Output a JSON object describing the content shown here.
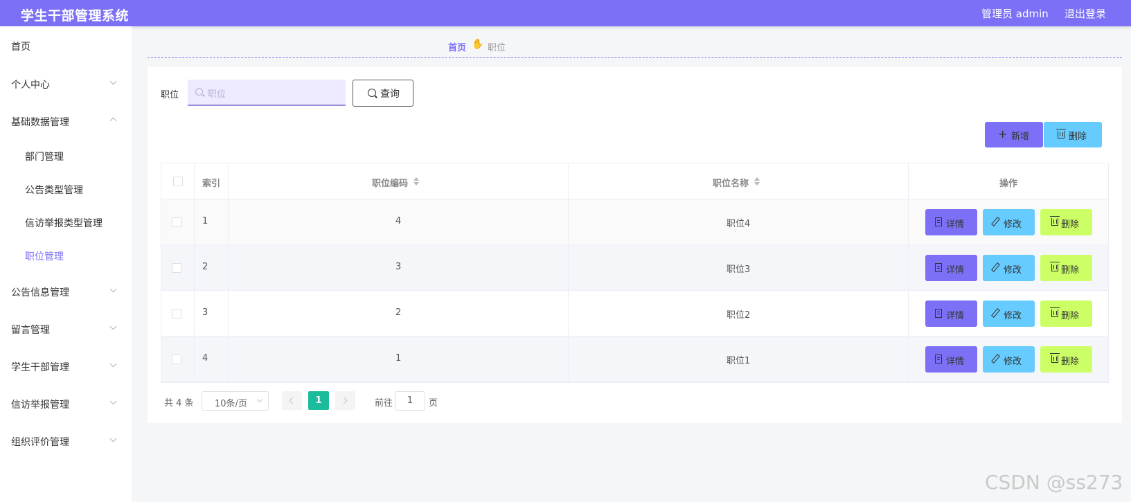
{
  "header": {
    "title": "学生干部管理系统",
    "user_label": "管理员 admin",
    "logout_label": "退出登录"
  },
  "sidebar": {
    "items": [
      {
        "label": "首页"
      },
      {
        "label": "个人中心"
      },
      {
        "label": "基础数据管理"
      },
      {
        "label": "部门管理"
      },
      {
        "label": "公告类型管理"
      },
      {
        "label": "信访举报类型管理"
      },
      {
        "label": "职位管理"
      },
      {
        "label": "公告信息管理"
      },
      {
        "label": "留言管理"
      },
      {
        "label": "学生干部管理"
      },
      {
        "label": "信访举报管理"
      },
      {
        "label": "组织评价管理"
      }
    ],
    "active_item": "职位管理"
  },
  "breadcrumb": {
    "home": "首页",
    "current": "职位"
  },
  "search": {
    "label": "职位",
    "placeholder": "职位",
    "query_label": "查询"
  },
  "toolbar": {
    "add_label": "新增",
    "delete_label": "删除"
  },
  "table": {
    "columns": [
      "索引",
      "职位编码",
      "职位名称",
      "操作"
    ],
    "rows": [
      {
        "index": "1",
        "code": "4",
        "name": "职位4"
      },
      {
        "index": "2",
        "code": "3",
        "name": "职位3"
      },
      {
        "index": "3",
        "code": "2",
        "name": "职位2"
      },
      {
        "index": "4",
        "code": "1",
        "name": "职位1"
      }
    ],
    "actions": {
      "detail": "详情",
      "edit": "修改",
      "delete": "删除"
    }
  },
  "pagination": {
    "total_text": "共 4 条",
    "page_size": "10条/页",
    "current_page": "1",
    "goto_label": "前往",
    "goto_value": "1",
    "page_suffix": "页"
  },
  "watermark": "CSDN @ss273",
  "colors": {
    "primary": "#7b70f6",
    "info": "#66ccff",
    "warning": "#ccff66",
    "page_active": "#1abc9c"
  }
}
